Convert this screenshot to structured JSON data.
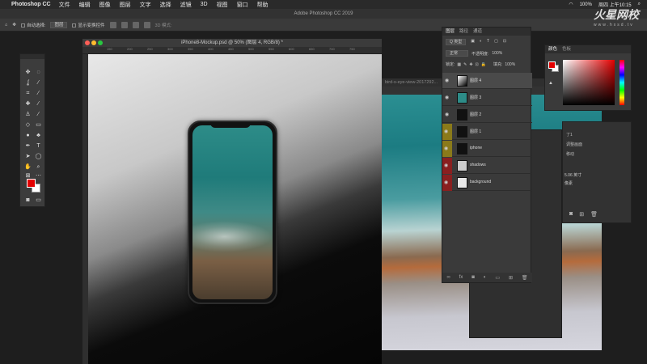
{
  "menubar": {
    "app_name": "Photoshop CC",
    "items": [
      "文件",
      "编辑",
      "图像",
      "图层",
      "文字",
      "选择",
      "滤镜",
      "3D",
      "视图",
      "窗口",
      "帮助"
    ],
    "battery": "100%",
    "clock": "周四 上午10:15"
  },
  "app_title": "Adobe Photoshop CC 2019",
  "options": {
    "auto_select_label": "自动选择:",
    "auto_select_value": "图层",
    "show_transform_label": "显示变换控件",
    "mode_3d": "3D 模式:"
  },
  "document": {
    "title": "iPhone8-Mockup.psd @ 50% (图层 4, RGB/8) *",
    "ruler_marks": [
      "150",
      "200",
      "250",
      "300",
      "350",
      "400",
      "450",
      "500",
      "550",
      "600",
      "650",
      "700",
      "750"
    ]
  },
  "photo_window": {
    "title": "bird-s-eye-view-2017292..."
  },
  "layers_panel": {
    "tabs": [
      "图层",
      "路径",
      "通道"
    ],
    "kind_filter": "Q 类型",
    "blend_mode": "正常",
    "opacity_label": "不透明度:",
    "opacity_value": "100%",
    "lock_label": "锁定:",
    "fill_label": "填充:",
    "fill_value": "100%",
    "layers": [
      {
        "name": "图层 4",
        "selected": true
      },
      {
        "name": "图层 3",
        "selected": false
      },
      {
        "name": "图层 2",
        "selected": false
      },
      {
        "name": "图层 1",
        "selected": false
      },
      {
        "name": "iphone",
        "selected": false
      },
      {
        "name": "shadows",
        "selected": false
      },
      {
        "name": "background",
        "selected": false
      }
    ]
  },
  "color_panel": {
    "tabs": [
      "颜色",
      "色板"
    ]
  },
  "right_panel": {
    "props": [
      "了1",
      "调整画面",
      "移动"
    ],
    "value": "5.06 英寸",
    "unit": "像素"
  },
  "watermark": {
    "brand": "火星网校",
    "url": "www.hxsd.tv"
  },
  "colors": {
    "foreground": "#e30000",
    "background": "#ffffff"
  }
}
